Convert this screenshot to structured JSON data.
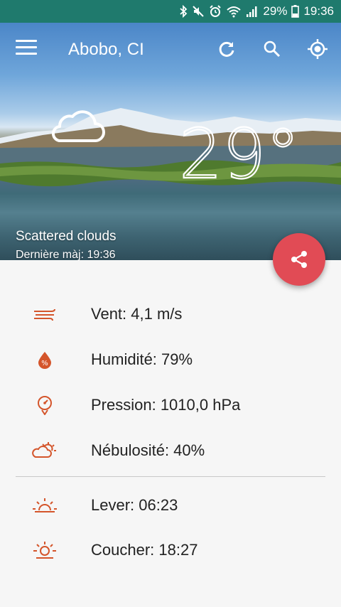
{
  "status_bar": {
    "battery": "29%",
    "time": "19:36",
    "icons": [
      "bluetooth-icon",
      "mute-icon",
      "alarm-icon",
      "wifi-icon",
      "signal-icon",
      "battery-icon"
    ]
  },
  "toolbar": {
    "location": "Abobo, CI",
    "icons": [
      "menu-icon",
      "refresh-icon",
      "search-icon",
      "my-location-icon"
    ]
  },
  "weather": {
    "temperature": "29°",
    "condition_icon": "cloud-icon",
    "description": "Scattered clouds",
    "last_update": "Dernière màj: 19:36"
  },
  "details": [
    {
      "icon": "wind-icon",
      "text": "Vent: 4,1 m/s"
    },
    {
      "icon": "humidity-icon",
      "text": "Humidité: 79%"
    },
    {
      "icon": "pressure-icon",
      "text": "Pression: 1010,0 hPa"
    },
    {
      "icon": "cloudiness-icon",
      "text": "Nébulosité: 40%"
    }
  ],
  "sun": [
    {
      "icon": "sunrise-icon",
      "text": "Lever: 06:23"
    },
    {
      "icon": "sunset-icon",
      "text": "Coucher: 18:27"
    }
  ],
  "colors": {
    "status_bar": "#1f7a6d",
    "accent": "#e14b55",
    "icon_orange": "#d4552b"
  }
}
